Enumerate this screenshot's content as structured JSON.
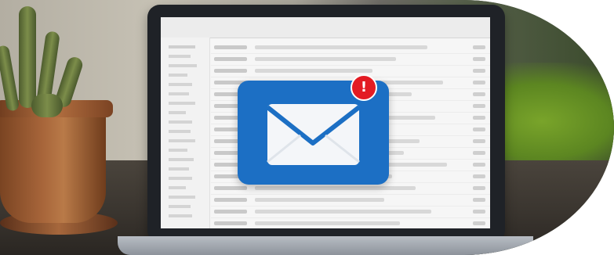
{
  "scene": {
    "description_role": "photo-banner",
    "accent_colors": {
      "envelope_card": "#1c6fc4",
      "alert_badge": "#e31b23",
      "plant_green": "#79a42a"
    }
  },
  "screen": {
    "icons": [
      "inbox-icon",
      "envelope-icon",
      "exclamation-icon"
    ],
    "alert_badge_symbol": "!"
  }
}
